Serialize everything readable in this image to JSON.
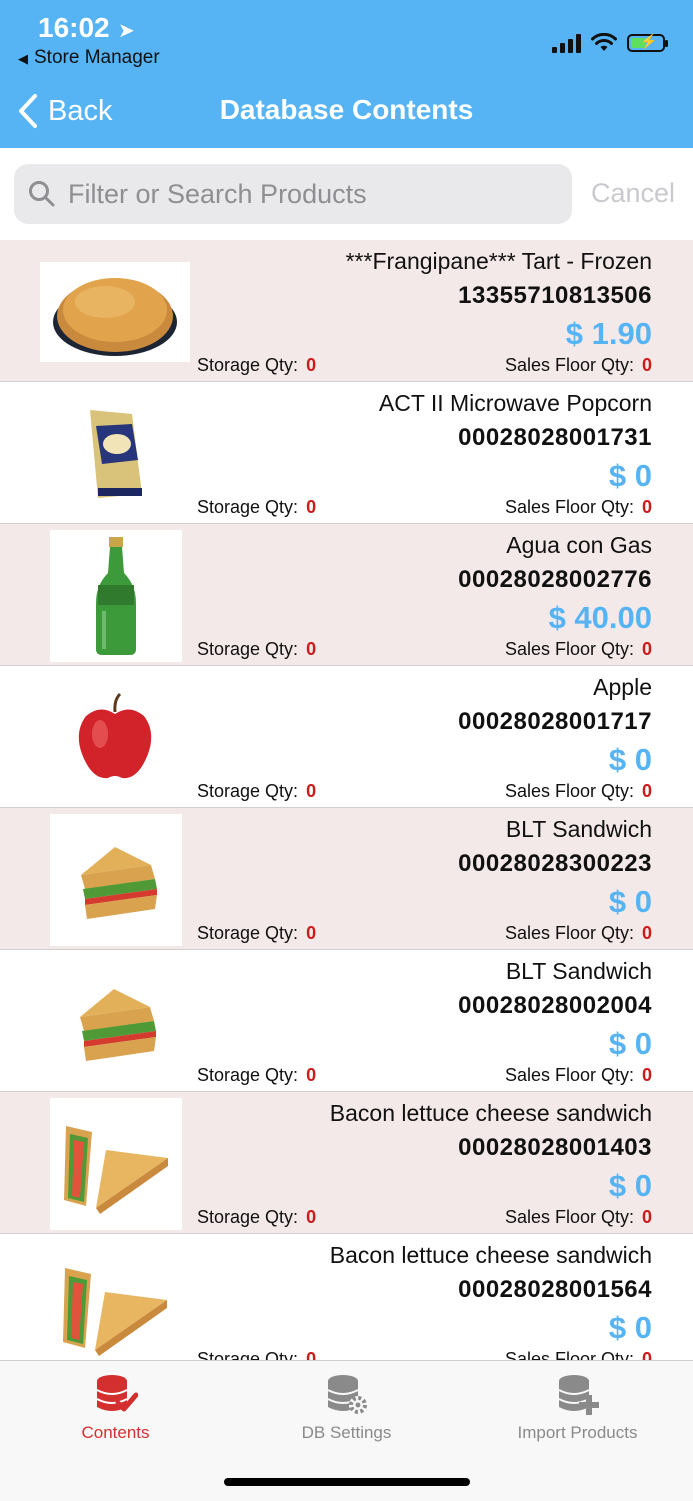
{
  "status_bar": {
    "time": "16:02",
    "back_app": "Store Manager"
  },
  "nav": {
    "back_label": "Back",
    "title": "Database Contents"
  },
  "search": {
    "placeholder": "Filter or Search Products",
    "cancel_label": "Cancel"
  },
  "labels": {
    "storage_qty": "Storage Qty:",
    "sales_floor_qty": "Sales Floor Qty:"
  },
  "products": [
    {
      "name": "***Frangipane*** Tart - Frozen",
      "sku": "13355710813506",
      "price": "$ 1.90",
      "storage_qty": "0",
      "sales_floor_qty": "0",
      "image": "tart-image"
    },
    {
      "name": "ACT II Microwave Popcorn",
      "sku": "00028028001731",
      "price": "$ 0",
      "storage_qty": "0",
      "sales_floor_qty": "0",
      "image": "popcorn-bag-image"
    },
    {
      "name": "Agua con Gas",
      "sku": "00028028002776",
      "price": "$ 40.00",
      "storage_qty": "0",
      "sales_floor_qty": "0",
      "image": "green-bottle-image"
    },
    {
      "name": "Apple",
      "sku": "00028028001717",
      "price": "$ 0",
      "storage_qty": "0",
      "sales_floor_qty": "0",
      "image": "apple-image"
    },
    {
      "name": "BLT Sandwich",
      "sku": "00028028300223",
      "price": "$ 0",
      "storage_qty": "0",
      "sales_floor_qty": "0",
      "image": "sandwich-image"
    },
    {
      "name": "BLT Sandwich",
      "sku": "00028028002004",
      "price": "$ 0",
      "storage_qty": "0",
      "sales_floor_qty": "0",
      "image": "sandwich-image"
    },
    {
      "name": "Bacon lettuce cheese sandwich",
      "sku": "00028028001403",
      "price": "$ 0",
      "storage_qty": "0",
      "sales_floor_qty": "0",
      "image": "triangle-sandwich-image"
    },
    {
      "name": "Bacon lettuce cheese sandwich",
      "sku": "00028028001564",
      "price": "$ 0",
      "storage_qty": "0",
      "sales_floor_qty": "0",
      "image": "triangle-sandwich-image"
    }
  ],
  "tabs": [
    {
      "label": "Contents",
      "icon": "database-check-icon",
      "active": true
    },
    {
      "label": "DB Settings",
      "icon": "database-gear-icon",
      "active": false
    },
    {
      "label": "Import Products",
      "icon": "database-plus-icon",
      "active": false
    }
  ],
  "colors": {
    "header": "#56b4f5",
    "price": "#56b4f5",
    "qty": "#cc1b1b",
    "active_tab": "#d32f2f",
    "alt_row": "#f4e9e9"
  }
}
